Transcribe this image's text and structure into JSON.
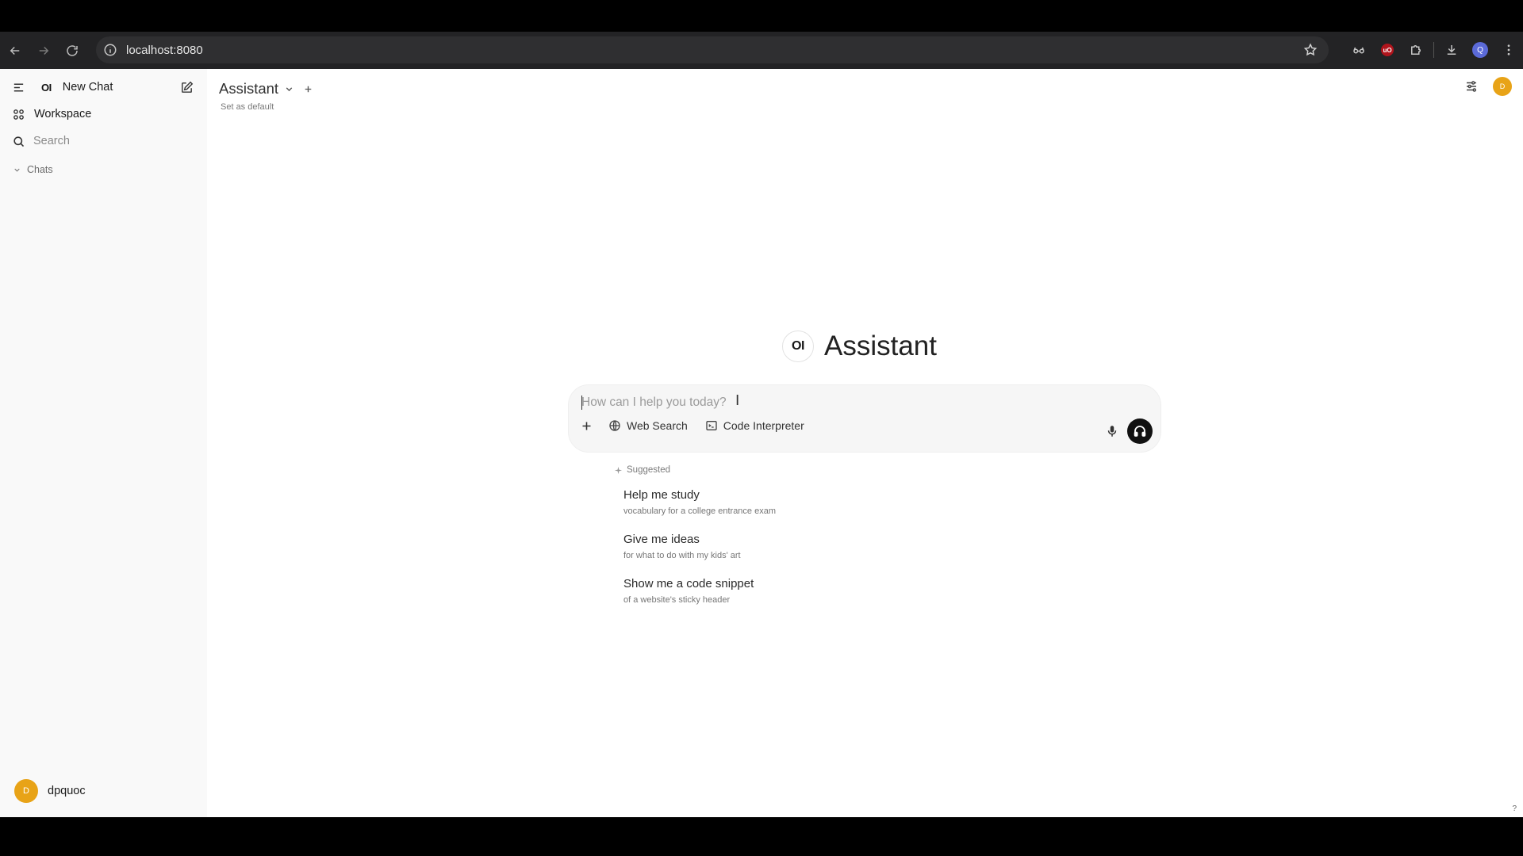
{
  "browser": {
    "url": "localhost:8080",
    "profile_initial": "Q",
    "ublock_label": "uO"
  },
  "sidebar": {
    "logo": "OI",
    "new_chat": "New Chat",
    "workspace": "Workspace",
    "search_placeholder": "Search",
    "chats_label": "Chats",
    "user_initial": "D",
    "user_name": "dpquoc"
  },
  "header": {
    "model_name": "Assistant",
    "set_default": "Set as default",
    "avatar_initial": "D"
  },
  "main": {
    "hero_logo": "OI",
    "hero_title": "Assistant",
    "input_placeholder": "How can I help you today?",
    "tools": {
      "web_search": "Web Search",
      "code_interpreter": "Code Interpreter"
    },
    "suggested_label": "Suggested",
    "suggestions": [
      {
        "title": "Help me study",
        "subtitle": "vocabulary for a college entrance exam"
      },
      {
        "title": "Give me ideas",
        "subtitle": "for what to do with my kids' art"
      },
      {
        "title": "Show me a code snippet",
        "subtitle": "of a website's sticky header"
      }
    ],
    "help": "?"
  },
  "colors": {
    "avatar": "#e8a317",
    "sidebar_bg": "#f9f9f9",
    "chrome_bg": "#232325"
  }
}
